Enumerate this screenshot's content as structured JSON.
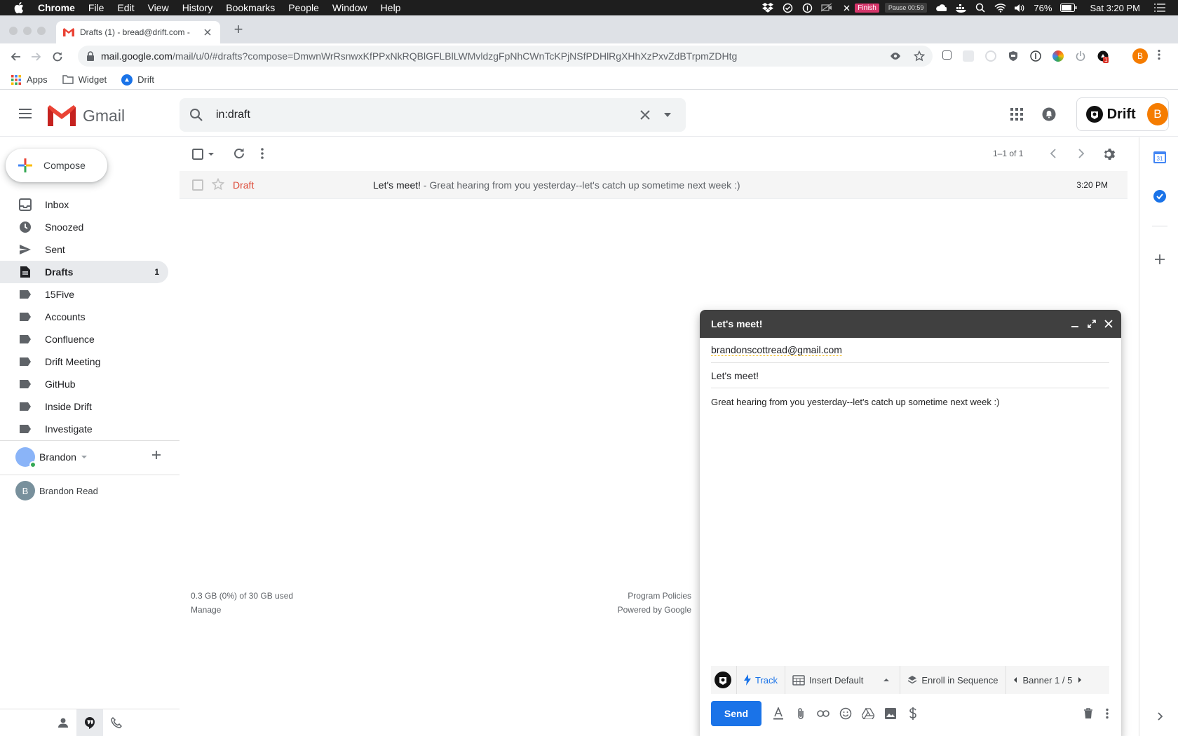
{
  "menubar": {
    "app": "Chrome",
    "items": [
      "File",
      "Edit",
      "View",
      "History",
      "Bookmarks",
      "People",
      "Window",
      "Help"
    ],
    "finish": "Finish",
    "pause": "Pause 00:59",
    "battery": "76%",
    "clock": "Sat 3:20 PM"
  },
  "browser": {
    "tab_title": "Drafts (1) - bread@drift.com -",
    "url_host": "mail.google.com",
    "url_rest": "/mail/u/0/#drafts?compose=DmwnWrRsnwxKfPPxNkRQBlGFLBlLWMvldzgFpNhCWnTcKPjNSfPDHlRgXHhXzPxvZdBTrpmZDHtg",
    "profile_initial": "B",
    "ext_badge": "1",
    "bookmarks": [
      "Apps",
      "Widget",
      "Drift"
    ]
  },
  "gmail": {
    "brand": "Gmail",
    "search_value": "in:draft",
    "drift_label": "Drift",
    "avatar_initial": "B"
  },
  "sidebar": {
    "compose": "Compose",
    "items": [
      {
        "label": "Inbox",
        "icon": "inbox-icon"
      },
      {
        "label": "Snoozed",
        "icon": "clock-icon"
      },
      {
        "label": "Sent",
        "icon": "send-icon"
      },
      {
        "label": "Drafts",
        "icon": "draft-icon",
        "count": "1",
        "active": true
      },
      {
        "label": "15Five",
        "icon": "label-icon"
      },
      {
        "label": "Accounts",
        "icon": "label-icon"
      },
      {
        "label": "Confluence",
        "icon": "label-icon"
      },
      {
        "label": "Drift Meeting",
        "icon": "label-icon"
      },
      {
        "label": "GitHub",
        "icon": "label-icon"
      },
      {
        "label": "Inside Drift",
        "icon": "label-icon"
      },
      {
        "label": "Investigate",
        "icon": "label-icon"
      }
    ],
    "hangouts_user": "Brandon",
    "contact_initial": "B",
    "contact_name": "Brandon Read"
  },
  "list": {
    "pager": "1–1 of 1",
    "rows": [
      {
        "sender": "Draft",
        "subject": "Let's meet!",
        "snippet": " - Great hearing from you yesterday--let's catch up sometime next week :)",
        "time": "3:20 PM"
      }
    ],
    "storage": "0.3 GB (0%) of 30 GB used",
    "manage": "Manage",
    "program_policies": "Program Policies",
    "powered_by": "Powered by Google"
  },
  "compose_window": {
    "title": "Let's meet!",
    "to": "brandonscottread@gmail.com",
    "subject": "Let's meet!",
    "body": "Great hearing from you yesterday--let's catch up sometime next week :)",
    "track": "Track",
    "insert_default": "Insert Default",
    "enroll": "Enroll in Sequence",
    "banner": "Banner 1 / 5",
    "send": "Send"
  },
  "colors": {
    "accent_blue": "#1a73e8",
    "draft_red": "#dd4b39",
    "compose_header": "#404040",
    "avatar_orange": "#f57c00"
  }
}
